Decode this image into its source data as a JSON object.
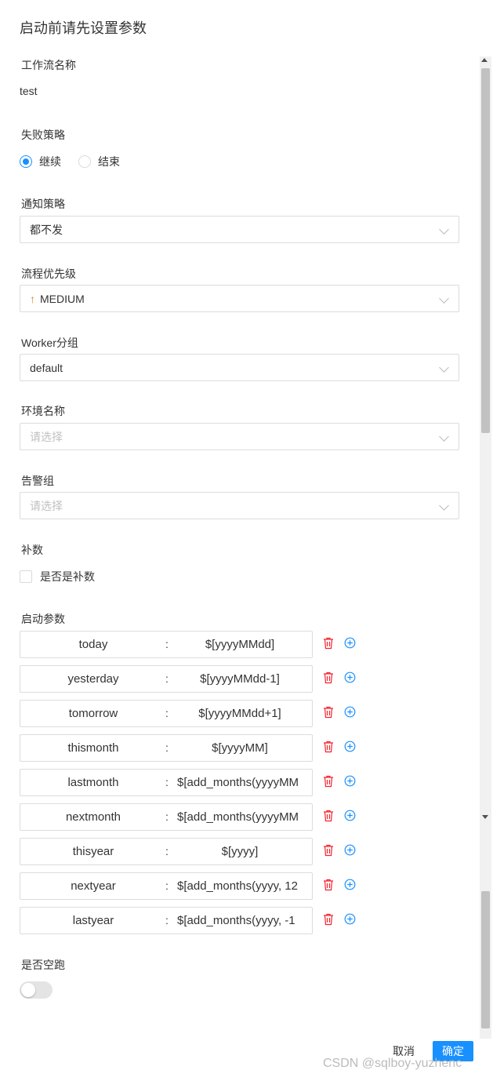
{
  "dialog": {
    "title": "启动前请先设置参数"
  },
  "form": {
    "workflow_name": {
      "label": "工作流名称",
      "value": "test"
    },
    "failure_strategy": {
      "label": "失败策略",
      "options": [
        {
          "label": "继续",
          "checked": true
        },
        {
          "label": "结束",
          "checked": false
        }
      ]
    },
    "notify_strategy": {
      "label": "通知策略",
      "value": "都不发"
    },
    "priority": {
      "label": "流程优先级",
      "value": "MEDIUM",
      "icon": "arrow-up-icon",
      "icon_color": "#e67e22"
    },
    "worker_group": {
      "label": "Worker分组",
      "value": "default"
    },
    "environment": {
      "label": "环境名称",
      "placeholder": "请选择"
    },
    "alert_group": {
      "label": "告警组",
      "placeholder": "请选择"
    },
    "complement": {
      "label": "补数",
      "checkbox_label": "是否是补数",
      "checked": false
    },
    "startup_params": {
      "label": "启动参数",
      "separator": ":",
      "items": [
        {
          "key": "today",
          "value": "$[yyyyMMdd]"
        },
        {
          "key": "yesterday",
          "value": "$[yyyyMMdd-1]"
        },
        {
          "key": "tomorrow",
          "value": "$[yyyyMMdd+1]"
        },
        {
          "key": "thismonth",
          "value": "$[yyyyMM]"
        },
        {
          "key": "lastmonth",
          "value": "$[add_months(yyyyMM"
        },
        {
          "key": "nextmonth",
          "value": "$[add_months(yyyyMM"
        },
        {
          "key": "thisyear",
          "value": "$[yyyy]"
        },
        {
          "key": "nextyear",
          "value": "$[add_months(yyyy, 12"
        },
        {
          "key": "lastyear",
          "value": "$[add_months(yyyy, -1"
        }
      ]
    },
    "dry_run": {
      "label": "是否空跑",
      "on": false
    }
  },
  "footer": {
    "cancel_label": "取消",
    "confirm_label": "确定"
  },
  "watermark": "CSDN @sqlboy-yuzhenc",
  "colors": {
    "primary": "#1890ff",
    "delete_icon": "#f5222d",
    "add_icon": "#1890ff",
    "priority_medium": "#e67e22"
  }
}
